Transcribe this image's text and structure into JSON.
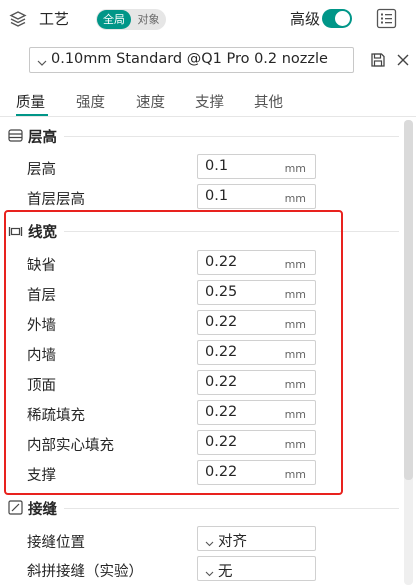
{
  "header": {
    "title": "工艺",
    "scope": {
      "active": "全局",
      "inactive": "对象"
    },
    "advanced_label": "高级",
    "advanced_on": true,
    "accent_color": "#009688"
  },
  "preset": {
    "value": "0.10mm Standard @Q1 Pro 0.2 nozzle"
  },
  "tabs": [
    {
      "label": "质量",
      "active": true
    },
    {
      "label": "强度",
      "active": false
    },
    {
      "label": "速度",
      "active": false
    },
    {
      "label": "支撑",
      "active": false
    },
    {
      "label": "其他",
      "active": false
    }
  ],
  "sections": {
    "layer_height": {
      "title": "层高",
      "icon": "layer-height-icon",
      "rows": [
        {
          "label": "层高",
          "value": "0.1",
          "unit": "mm"
        },
        {
          "label": "首层层高",
          "value": "0.1",
          "unit": "mm"
        }
      ]
    },
    "line_width": {
      "title": "线宽",
      "icon": "line-width-icon",
      "rows": [
        {
          "label": "缺省",
          "value": "0.22",
          "unit": "mm"
        },
        {
          "label": "首层",
          "value": "0.25",
          "unit": "mm"
        },
        {
          "label": "外墙",
          "value": "0.22",
          "unit": "mm"
        },
        {
          "label": "内墙",
          "value": "0.22",
          "unit": "mm"
        },
        {
          "label": "顶面",
          "value": "0.22",
          "unit": "mm"
        },
        {
          "label": "稀疏填充",
          "value": "0.22",
          "unit": "mm"
        },
        {
          "label": "内部实心填充",
          "value": "0.22",
          "unit": "mm"
        },
        {
          "label": "支撑",
          "value": "0.22",
          "unit": "mm"
        }
      ]
    },
    "seam": {
      "title": "接缝",
      "icon": "seam-icon",
      "rows": [
        {
          "label": "接缝位置",
          "value": "对齐"
        },
        {
          "label": "斜拼接缝（实验）",
          "value": "无"
        }
      ]
    }
  },
  "highlight_color": "#e8221e"
}
